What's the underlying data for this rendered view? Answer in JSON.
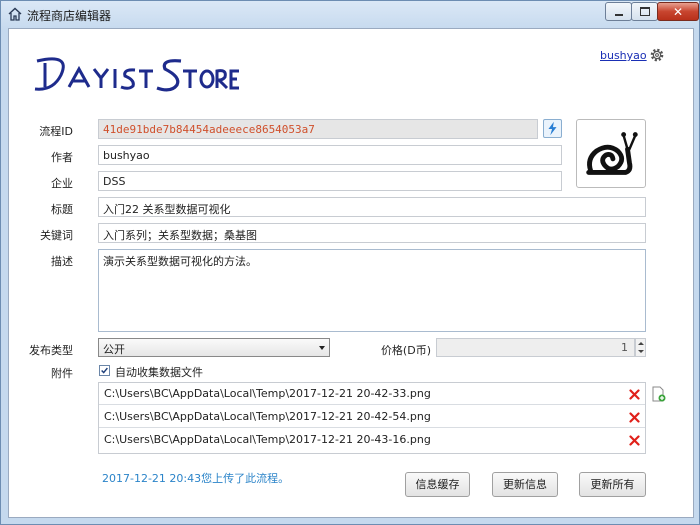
{
  "window": {
    "title": "流程商店编辑器"
  },
  "header": {
    "user": "bushyao"
  },
  "form": {
    "id_label": "流程ID",
    "id_value": "41de91bde7b84454adeeece8654053a7",
    "author_label": "作者",
    "author_value": "bushyao",
    "company_label": "企业",
    "company_value": "DSS",
    "title_label": "标题",
    "title_value": "入门22 关系型数据可视化",
    "keywords_label": "关键词",
    "keywords_value": "入门系列；关系型数据；桑基图",
    "desc_label": "描述",
    "desc_value": "演示关系型数据可视化的方法。",
    "publish_label": "发布类型",
    "publish_value": "公开",
    "price_label": "价格(D币)",
    "price_value": "1",
    "attach_label": "附件",
    "auto_collect_label": "自动收集数据文件",
    "auto_collect_checked": true
  },
  "attachments": [
    "C:\\Users\\BC\\AppData\\Local\\Temp\\2017-12-21 20-42-33.png",
    "C:\\Users\\BC\\AppData\\Local\\Temp\\2017-12-21 20-42-54.png",
    "C:\\Users\\BC\\AppData\\Local\\Temp\\2017-12-21 20-43-16.png"
  ],
  "status": "2017-12-21 20:43您上传了此流程。",
  "buttons": {
    "cache": "信息缓存",
    "update_info": "更新信息",
    "update_all": "更新所有"
  },
  "colors": {
    "accent": "#2b84c9",
    "id_text": "#d0502c",
    "delete": "#e0201a",
    "logo": "#1e2b8c"
  },
  "icons": {
    "app": "home-icon",
    "settings": "gear-icon",
    "generate": "lightning-icon",
    "avatar": "snail-icon",
    "delete": "red-x-icon",
    "add": "add-file-icon"
  }
}
